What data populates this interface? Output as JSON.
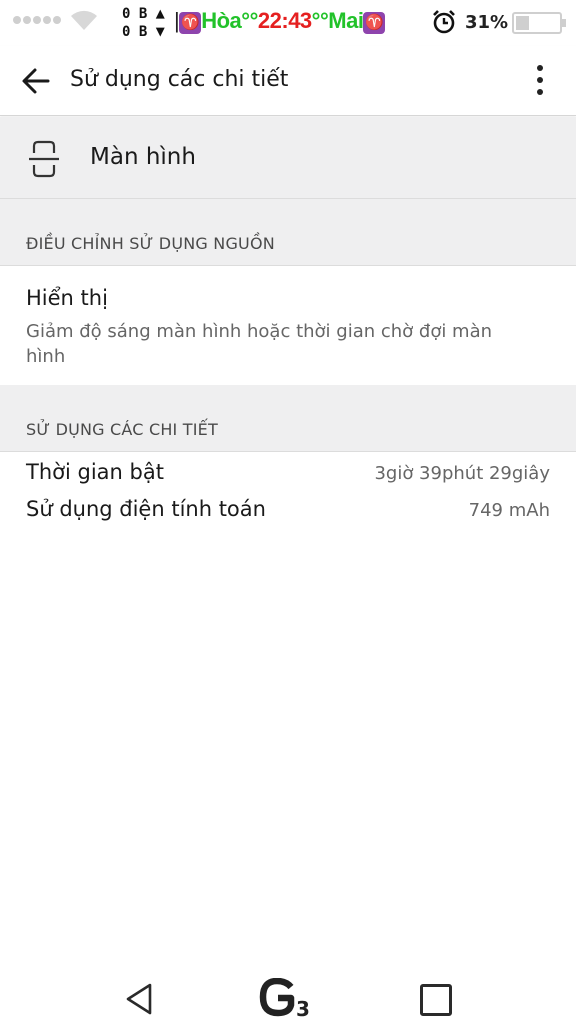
{
  "status_bar": {
    "traffic_up": "0 B",
    "traffic_down": "0 B",
    "carrier_left": "Hòa°°",
    "clock": "22:43",
    "carrier_right": "°°Mai",
    "battery_percent": "31%",
    "battery_level": 0.31
  },
  "app_bar": {
    "title": "Sử dụng các chi tiết",
    "back_icon": "arrow-left-icon",
    "more_icon": "more-vertical-icon"
  },
  "component": {
    "icon": "screen-icon",
    "label": "Màn hình"
  },
  "sections": {
    "adjust_header": "ĐIỀU CHỈNH SỬ DỤNG NGUỒN",
    "details_header": "SỬ DỤNG CÁC CHI TIẾT"
  },
  "display_setting": {
    "title": "Hiển thị",
    "description": "Giảm độ sáng màn hình hoặc thời gian chờ đợi màn hình"
  },
  "details": [
    {
      "label": "Thời gian bật",
      "value": "3giờ 39phút 29giây"
    },
    {
      "label": "Sử dụng điện tính toán",
      "value": "749 mAh"
    }
  ],
  "nav_bar": {
    "back_icon": "nav-back-triangle-icon",
    "home_icon": "g3-home-icon",
    "recents_icon": "recents-square-icon"
  },
  "colors": {
    "section_bg": "#efeff0",
    "carrier_green": "#22c22a",
    "clock_red": "#e52020"
  }
}
